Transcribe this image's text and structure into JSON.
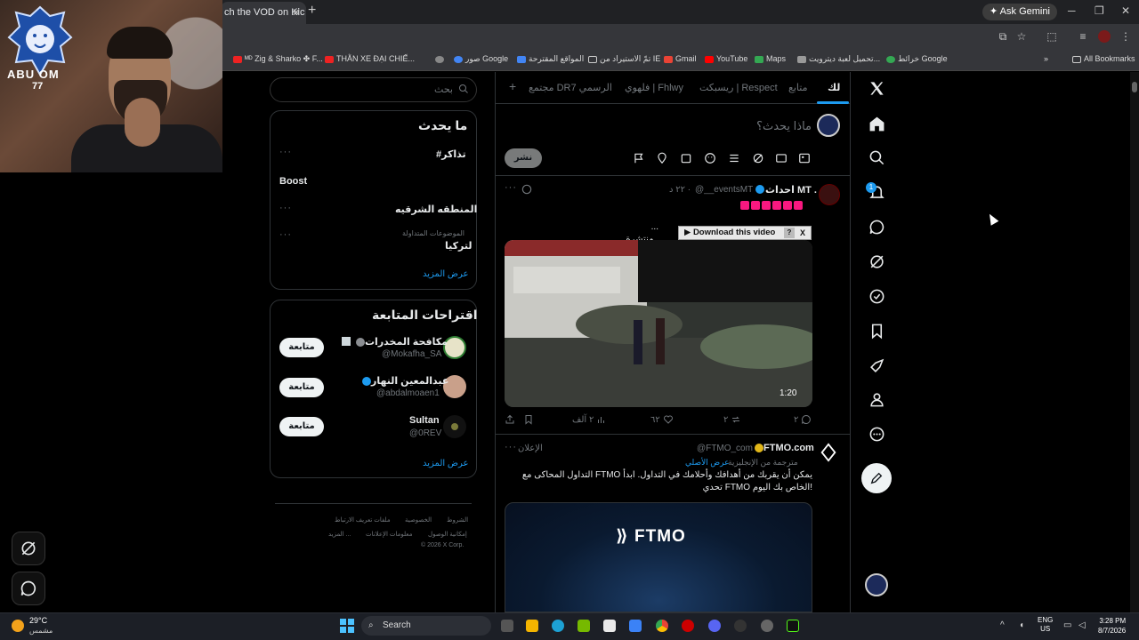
{
  "browser": {
    "tab_title": "ch the VOD on Kic",
    "gemini_label": "Ask Gemini",
    "bookmarks": [
      "ᴹᴰ Zig & Sharko ✤ F...",
      "THẰN XE ĐẠI CHIẾ...",
      "صور Google",
      "المواقع المقترحة",
      "تمّ الاستيراد من IE",
      "Gmail",
      "YouTube",
      "Maps",
      "تحميل لعبة ديترويت...",
      "خرائط Google"
    ],
    "all_bookmarks": "All Bookmarks"
  },
  "webcam": {
    "logo_text": "ABU OM",
    "logo_num": "77"
  },
  "feed": {
    "tabs": [
      "لك",
      "متابع",
      "ريسبكت | Respect",
      "فلهوي | Fhlwy",
      "مجتمع DR7 الرسمي"
    ],
    "compose_placeholder": "ماذا يحدث؟",
    "post_button": "نشر",
    "tweet1": {
      "name": "احداث MT .",
      "handle": "@__eventsMT",
      "time": "٢٢ د ·",
      "text_line2": "... منتشرة .",
      "download_bar": "▶ Download this video",
      "download_q": "?",
      "download_close": "X",
      "video_time": "1:20",
      "actions": {
        "reply": "٢",
        "retweet": "٢",
        "like": "٦٢",
        "views": "٢ آلف"
      }
    },
    "tweet2": {
      "name": "FTMO.com",
      "handle": "@FTMO_com",
      "promoted": "الإعلان",
      "translated": "مترجمة من الإنجليزية",
      "show_original": "عرض الأصلي",
      "text_line1": "التداول المحاكى مع FTMO يمكن أن يقربك من أهدافك وأحلامك في التداول. ابدأ",
      "text_line2": "تحدي FTMO الخاص بك اليوم!",
      "media_logo": "FTMO"
    }
  },
  "sidebar": {
    "search_placeholder": "بحث",
    "trending_title": "ما يحدث",
    "trends": [
      {
        "name": "#تذاكر",
        "sub": ""
      },
      {
        "name": "Boost",
        "sub": ""
      },
      {
        "name": "المنطقه الشرقيه",
        "sub": ""
      },
      {
        "name": "لتركيا",
        "sub": "الموضوعات المتداولة"
      }
    ],
    "show_more": "عرض المزيد",
    "suggestions_title": "اقتراحات المتابعة",
    "suggestions": [
      {
        "name": "مكافحة المخدرات",
        "handle": "@Mokafha_SA",
        "follow": "متابعة"
      },
      {
        "name": "عبدالمعين النهار",
        "handle": "@abdalmoaen1",
        "follow": "متابعة"
      },
      {
        "name": "Sultan",
        "handle": "@0REV",
        "follow": "متابعة"
      }
    ],
    "footer": {
      "row1": [
        "الشروط",
        "الخصوصية",
        "ملفات تعريف الارتباط"
      ],
      "row2": [
        "إمكانية الوصول",
        "معلومات الإعلانات",
        "المزيد ..."
      ],
      "copyright": "© 2026 X Corp."
    }
  },
  "taskbar": {
    "temp": "29°C",
    "weather": "مشمس",
    "search": "Search",
    "lang1": "ENG",
    "lang2": "US",
    "time": "3:28 PM",
    "date": "8/7/2026"
  },
  "colors": {
    "accent": "#1d9bf0",
    "bg": "#000000",
    "border": "#2f3336",
    "muted": "#71767b"
  }
}
